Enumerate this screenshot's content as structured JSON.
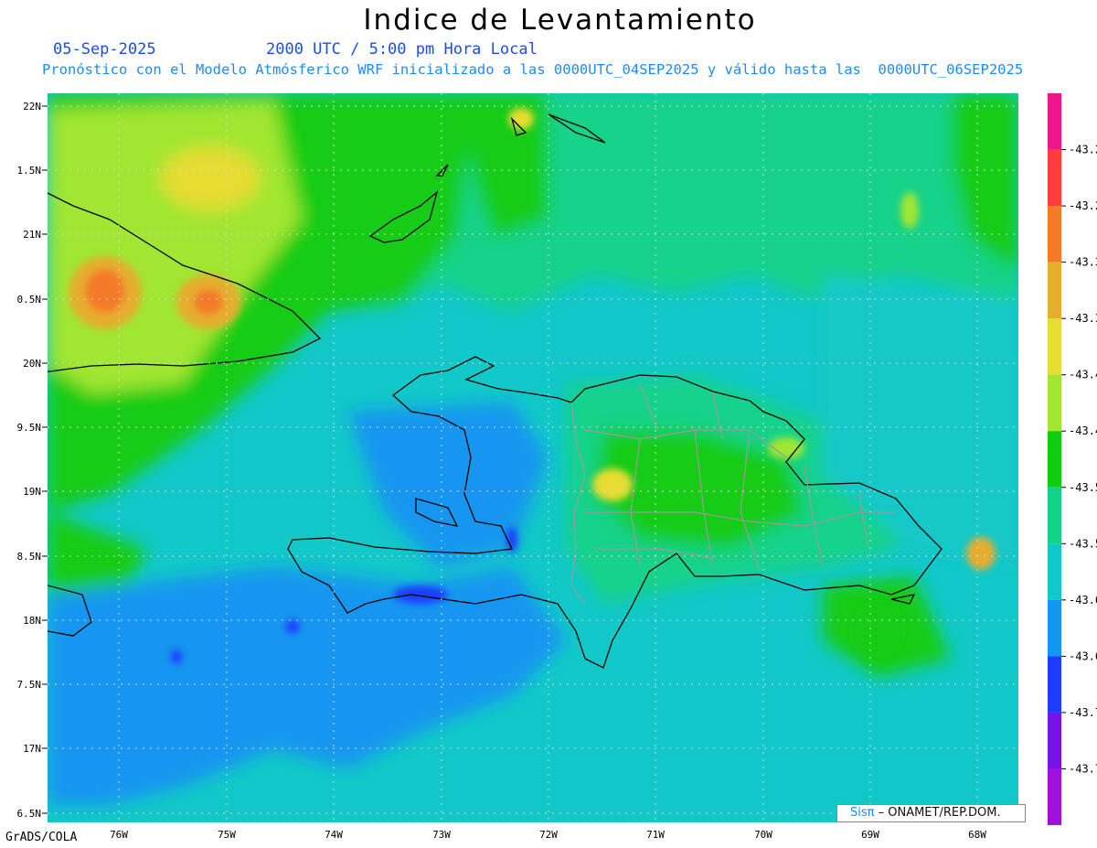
{
  "title": "Indice de Levantamiento",
  "date": "05-Sep-2025",
  "time": "2000 UTC / 5:00 pm Hora Local",
  "forecast_line": "Pronóstico con el Modelo Atmósferico WRF inicializado a las 0000UTC_04SEP2025 y válido hasta las  0000UTC_06SEP2025",
  "software": "GrADS/COLA",
  "credit": {
    "logo": "Sisπ",
    "text": " – ONAMET/REP.DOM."
  },
  "map": {
    "lat_labels": [
      "22N",
      "1.5N",
      "21N",
      "0.5N",
      "20N",
      "9.5N",
      "19N",
      "8.5N",
      "18N",
      "7.5N",
      "17N",
      "6.5N"
    ],
    "lon_labels": [
      "76W",
      "75W",
      "74W",
      "73W",
      "72W",
      "71W",
      "70W",
      "69W",
      "68W"
    ]
  },
  "colorbar": {
    "labels": [
      "-43.2",
      "-43.2",
      "-43.3",
      "-43.3",
      "-43.4",
      "-43.4",
      "-43.5",
      "-43.5",
      "-43.6",
      "-43.6",
      "-43.7",
      "-43.7"
    ],
    "colors": [
      "#f0158c",
      "#ff3c3c",
      "#f47a2a",
      "#e6ad2f",
      "#e6dc32",
      "#a0e632",
      "#12cc12",
      "#12d28a",
      "#12c8c8",
      "#1496f0",
      "#1e3cff",
      "#7a12e6",
      "#a012dc"
    ]
  }
}
